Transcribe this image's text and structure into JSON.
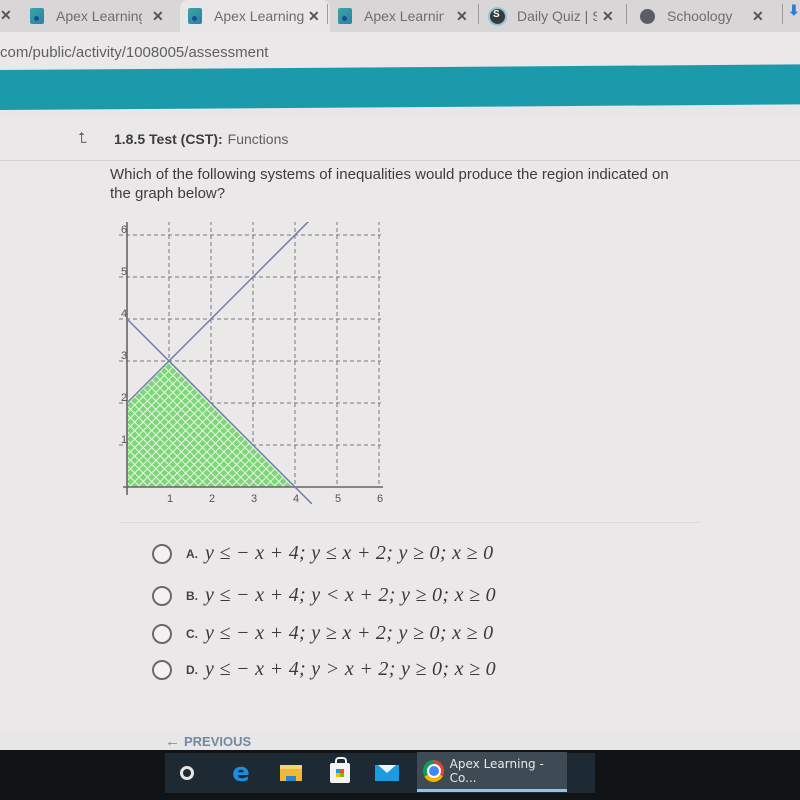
{
  "browser": {
    "tabs": [
      {
        "title": "Apex Learning",
        "favicon": "apex-icon",
        "active": false
      },
      {
        "title": "Apex Learning",
        "favicon": "apex-icon",
        "active": true
      },
      {
        "title": "Apex Learning",
        "favicon": "apex-icon",
        "active": false
      },
      {
        "title": "Daily Quiz | Sc",
        "favicon": "schoology-s-icon",
        "active": false
      },
      {
        "title": "Schoology",
        "favicon": "globe-icon",
        "active": false
      }
    ],
    "close_glyph": "✕",
    "url": "com/public/activity/1008005/assessment",
    "download_glyph": "⬇"
  },
  "colors": {
    "header_band": "#1a9aab",
    "shaded_region": "#6fcf6a",
    "line_color": "#6f7fa8"
  },
  "page": {
    "breadcrumb_icon": "⮤",
    "activity_code": "1.8.5 Test (CST):",
    "activity_subject": "Functions",
    "question": "Which of the following systems of inequalities would produce the region indicated on the graph below?",
    "options": [
      {
        "letter": "A.",
        "text": "y ≤ − x + 4; y ≤ x + 2; y ≥ 0; x ≥ 0"
      },
      {
        "letter": "B.",
        "text": "y ≤ − x + 4; y < x + 2; y ≥ 0; x ≥ 0"
      },
      {
        "letter": "C.",
        "text": "y ≤ − x + 4; y ≥ x + 2; y ≥ 0; x ≥ 0"
      },
      {
        "letter": "D.",
        "text": "y ≤ − x + 4; y > x + 2; y ≥ 0; x ≥ 0"
      }
    ],
    "previous_label": "PREVIOUS",
    "previous_arrow": "←"
  },
  "chart_data": {
    "type": "line",
    "title": "",
    "xlabel": "",
    "ylabel": "",
    "xlim": [
      0,
      6
    ],
    "ylim": [
      0,
      6
    ],
    "x_ticks": [
      "1",
      "2",
      "3",
      "4",
      "5",
      "6"
    ],
    "y_ticks": [
      "1",
      "2",
      "3",
      "4",
      "5",
      "6"
    ],
    "grid": true,
    "grid_style": "dashed",
    "series": [
      {
        "name": "y = -x + 4",
        "points": [
          [
            0,
            4
          ],
          [
            4,
            0
          ],
          [
            4.4,
            -0.4
          ]
        ]
      },
      {
        "name": "y = x + 2",
        "points": [
          [
            0,
            2
          ],
          [
            1,
            3
          ],
          [
            4.4,
            6.4
          ]
        ]
      }
    ],
    "shaded_region": {
      "description": "crosshatched green feasible region",
      "vertices": [
        [
          0,
          0
        ],
        [
          0,
          2
        ],
        [
          1,
          3
        ],
        [
          4,
          0
        ]
      ]
    }
  },
  "taskbar": {
    "items": [
      "cortana-icon",
      "edge-icon",
      "file-explorer-icon",
      "store-icon",
      "mail-icon"
    ],
    "active_window_label": "Apex Learning - Co..."
  }
}
